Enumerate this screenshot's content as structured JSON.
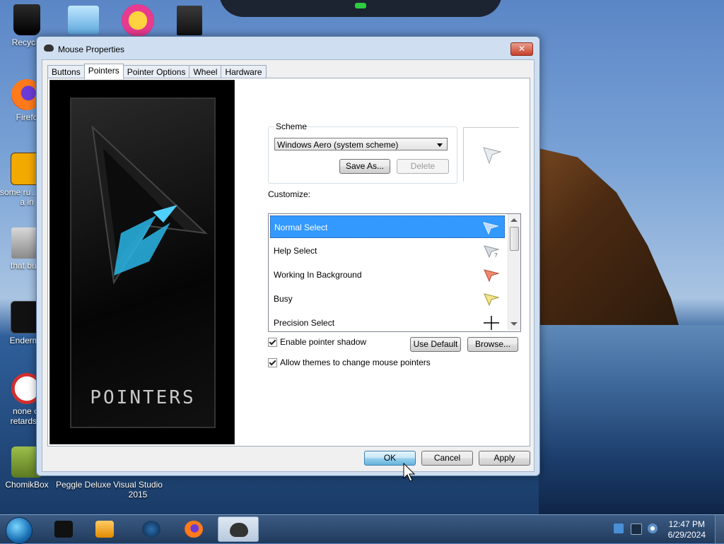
{
  "desktop": {
    "icons": [
      {
        "label": "Recycle",
        "icon": "recycle-bin-icon"
      },
      {
        "label": "Firefo",
        "icon": "firefox-icon"
      },
      {
        "label": "some ru… ran a in",
        "icon": "app-icon"
      },
      {
        "label": "that but i",
        "icon": "folder-icon"
      },
      {
        "label": "Enderma",
        "icon": "app-icon"
      },
      {
        "label": "none of retards k",
        "icon": "dinosaur-icon"
      },
      {
        "label": "ChomikBox",
        "icon": "chomikbox-icon"
      },
      {
        "label": "Peggle Deluxe",
        "icon": "peggle-icon"
      },
      {
        "label": "Visual Studio 2015",
        "icon": "visual-studio-icon"
      }
    ]
  },
  "window": {
    "title": "Mouse Properties",
    "close_glyph": "✕",
    "tabs": [
      "Buttons",
      "Pointers",
      "Pointer Options",
      "Wheel",
      "Hardware"
    ],
    "active_tab": "Pointers",
    "art_label": "POINTERS",
    "scheme": {
      "label": "Scheme",
      "selected": "Windows Aero (system scheme)",
      "save_as": "Save As...",
      "delete": "Delete"
    },
    "customize_label": "Customize:",
    "pointer_list": [
      {
        "name": "Normal Select",
        "icon": "arrow-cursor-icon"
      },
      {
        "name": "Help Select",
        "icon": "help-cursor-icon"
      },
      {
        "name": "Working In Background",
        "icon": "working-cursor-icon"
      },
      {
        "name": "Busy",
        "icon": "busy-cursor-icon"
      },
      {
        "name": "Precision Select",
        "icon": "crosshair-cursor-icon"
      }
    ],
    "enable_shadow_label": "Enable pointer shadow",
    "use_default": "Use Default",
    "browse": "Browse...",
    "allow_themes_label": "Allow themes to change mouse pointers",
    "ok": "OK",
    "cancel": "Cancel",
    "apply": "Apply"
  },
  "taskbar": {
    "time": "12:47 PM",
    "date": "6/29/2024"
  },
  "colors": {
    "selection": "#3399ff",
    "taskbar": "#203a5c"
  }
}
